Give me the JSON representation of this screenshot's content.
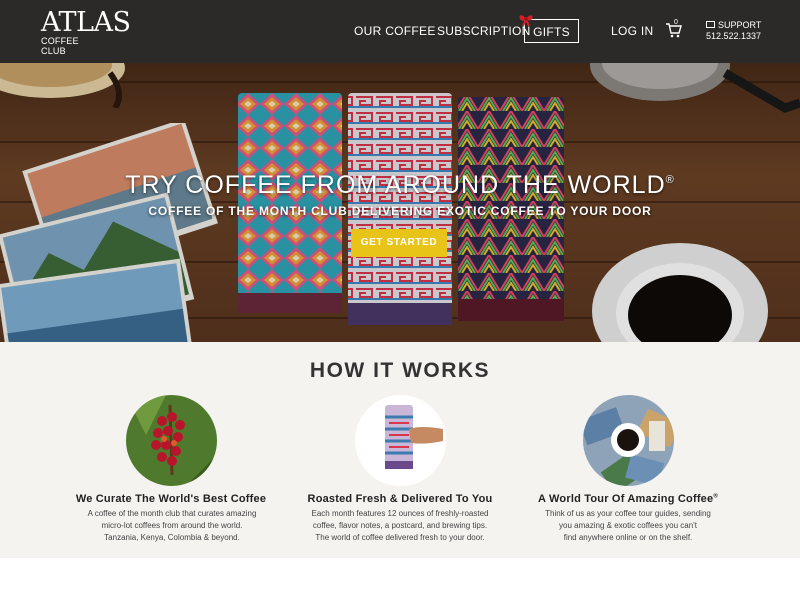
{
  "brand": {
    "name": "ATLAS",
    "tagline": "COFFEE CLUB"
  },
  "nav": {
    "items": [
      {
        "label": "OUR COFFEE"
      },
      {
        "label": "SUBSCRIPTION"
      },
      {
        "label": "GIFTS"
      },
      {
        "label": "LOG IN"
      }
    ],
    "cart_count": "0",
    "support_label": "SUPPORT",
    "support_phone": "512.522.1337"
  },
  "hero": {
    "title": "TRY COFFEE FROM AROUND THE WORLD",
    "title_mark": "®",
    "subtitle": "COFFEE OF THE MONTH CLUB DELIVERING EXOTIC COFFEE TO YOUR DOOR",
    "cta_label": "GET STARTED"
  },
  "how": {
    "title": "HOW IT WORKS",
    "steps": [
      {
        "title": "We Curate The World's Best Coffee",
        "mark": "",
        "desc_lines": [
          "A coffee of the month club that curates amazing",
          "micro-lot coffees from around the world.",
          "Tanzania, Kenya, Colombia & beyond."
        ],
        "icon": "coffee-cherries-icon"
      },
      {
        "title": "Roasted Fresh & Delivered To You",
        "mark": "",
        "desc_lines": [
          "Each month features 12 ounces of freshly-roasted",
          "coffee, flavor notes, a postcard, and brewing tips.",
          "The world of coffee delivered fresh to your door."
        ],
        "icon": "coffee-bag-in-hand-icon"
      },
      {
        "title": "A World Tour Of Amazing Coffee",
        "mark": "®",
        "desc_lines": [
          "Think of us as your coffee tour guides, sending",
          "you amazing & exotic coffees you can't",
          "find anywhere online or on the shelf."
        ],
        "icon": "postcards-and-cup-icon"
      }
    ]
  },
  "colors": {
    "nav_bg": "#2b2a28",
    "accent": "#e9c418",
    "section_bg": "#f5f3f0",
    "bow": "#d4202a"
  }
}
